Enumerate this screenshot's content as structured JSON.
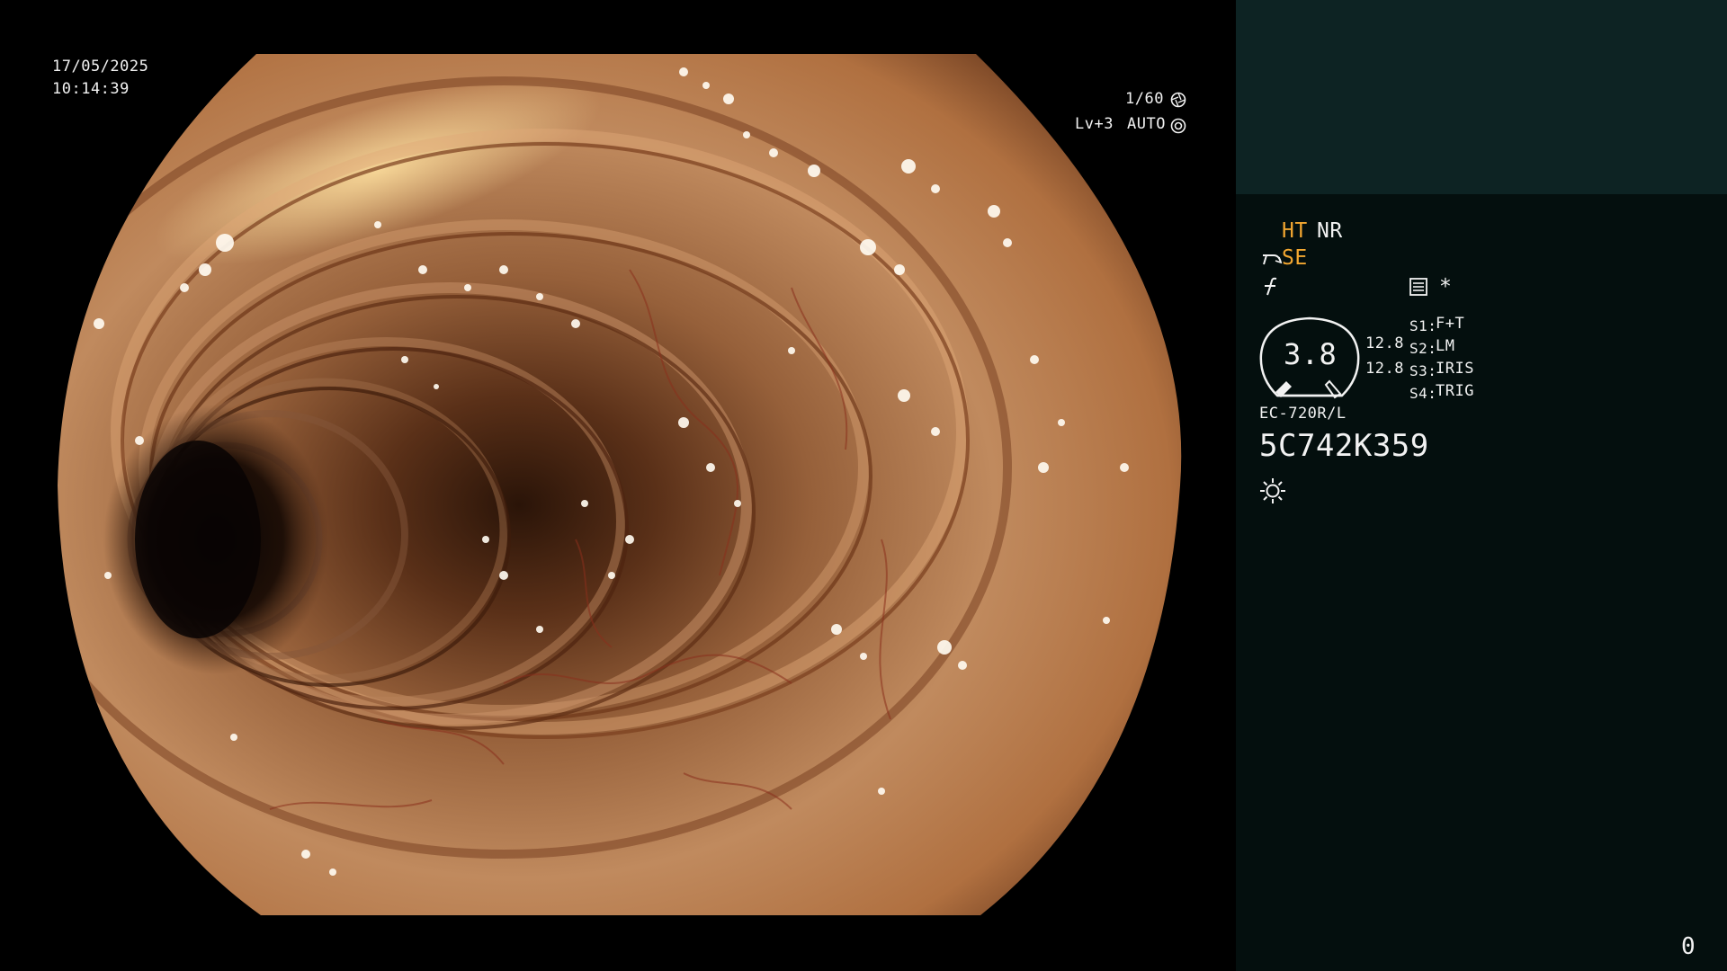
{
  "overlay": {
    "date": "17/05/2025",
    "time": "10:14:39",
    "shutter": "1/60",
    "exposure_level": "Lv+3",
    "exposure_mode": "AUTO",
    "icons": [
      "shutter-icon",
      "auto-iris-icon"
    ]
  },
  "panel": {
    "mode_ht": "HT",
    "mode_nr": "NR",
    "mode_se": "SE",
    "asterisk": "*",
    "gauge_value": "3.8",
    "readout_1": "12.8",
    "readout_2": "12.8",
    "switches": [
      {
        "key": "S1:",
        "value": "F+T"
      },
      {
        "key": "S2:",
        "value": "LM"
      },
      {
        "key": "S3:",
        "value": "IRIS"
      },
      {
        "key": "S4:",
        "value": "TRIG"
      }
    ],
    "scope_model": "EC-720R/L",
    "serial": "5C742K359",
    "counter": "0",
    "icons": [
      "scope-bend-icon",
      "freeze-icon",
      "menu-list-icon",
      "gauge-icon",
      "light-icon"
    ]
  },
  "colors": {
    "accent_amber": "#f3a731",
    "panel_top": "#0d2323",
    "panel_body": "#040f0e",
    "tissue": "#b07850"
  }
}
